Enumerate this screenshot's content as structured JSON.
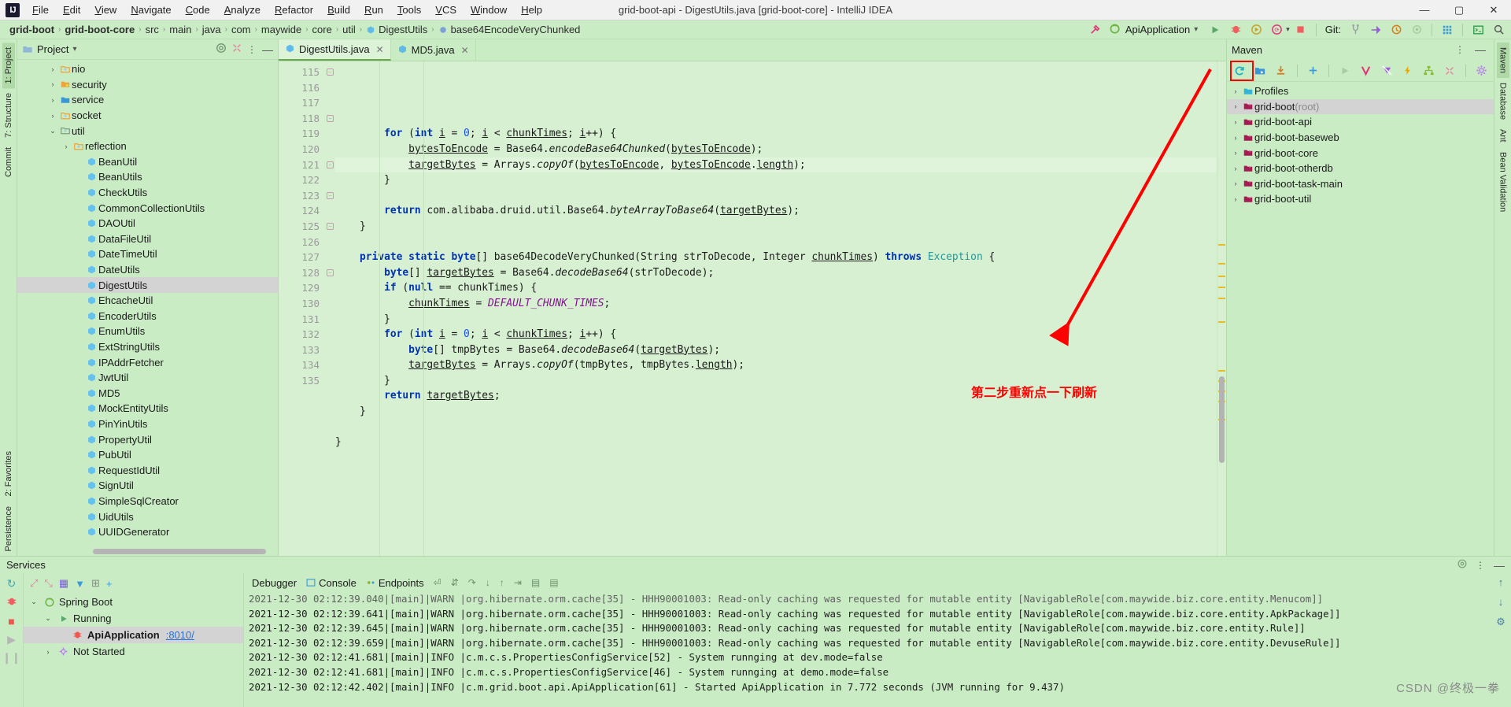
{
  "window": {
    "title": "grid-boot-api - DigestUtils.java [grid-boot-core] - IntelliJ IDEA",
    "minimize": "—",
    "maximize": "▢",
    "close": "✕"
  },
  "menu": [
    "File",
    "Edit",
    "View",
    "Navigate",
    "Code",
    "Analyze",
    "Refactor",
    "Build",
    "Run",
    "Tools",
    "VCS",
    "Window",
    "Help"
  ],
  "breadcrumb": [
    {
      "label": "grid-boot",
      "bold": true,
      "icon": ""
    },
    {
      "label": "grid-boot-core",
      "bold": true,
      "icon": ""
    },
    {
      "label": "src",
      "bold": false,
      "icon": ""
    },
    {
      "label": "main",
      "bold": false,
      "icon": ""
    },
    {
      "label": "java",
      "bold": false,
      "icon": ""
    },
    {
      "label": "com",
      "bold": false,
      "icon": ""
    },
    {
      "label": "maywide",
      "bold": false,
      "icon": ""
    },
    {
      "label": "core",
      "bold": false,
      "icon": ""
    },
    {
      "label": "util",
      "bold": false,
      "icon": ""
    },
    {
      "label": "DigestUtils",
      "bold": false,
      "icon": "class-icon"
    },
    {
      "label": "base64EncodeVeryChunked",
      "bold": false,
      "icon": "method-icon"
    }
  ],
  "toolbar": {
    "build_icon": "hammer-icon",
    "run_config": "ApiApplication",
    "run_config_icon": "spring-boot-icon",
    "dropdown_icon": "chevron-down-icon",
    "run_icon": "run-icon",
    "debug_icon": "debug-icon",
    "run_coverage_icon": "run-with-coverage-icon",
    "profile_icon": "profiler-icon",
    "stop_icon": "stop-icon",
    "git_label": "Git:",
    "branch_icon": "branch-icon",
    "update_icon": "update-project-icon",
    "history_icon": "history-icon",
    "commit_icon": "commit-icon",
    "layout_icon": "layout-icon",
    "terminal_icon": "terminal-icon",
    "search_icon": "search-icon"
  },
  "left_strip": [
    {
      "label": "1: Project",
      "icon": "project-icon",
      "active": true
    },
    {
      "label": "7: Structure",
      "icon": "structure-icon",
      "active": false
    },
    {
      "label": "Commit",
      "icon": "commit-icon",
      "active": false
    }
  ],
  "left_strip_bottom": [
    {
      "label": "2: Favorites",
      "icon": "favorites-icon"
    },
    {
      "label": "Persistence",
      "icon": "persistence-icon"
    }
  ],
  "right_strip": [
    {
      "label": "Maven",
      "icon": "maven-icon",
      "active": true
    },
    {
      "label": "Database",
      "icon": "database-icon",
      "active": false
    },
    {
      "label": "Ant",
      "icon": "ant-icon",
      "active": false
    },
    {
      "label": "Bean Validation",
      "icon": "bean-validation-icon",
      "active": false
    }
  ],
  "project_panel": {
    "title": "Project",
    "title_icon": "folder-icon",
    "dropdown_icon": "chevron-down-icon",
    "locate_icon": "target-icon",
    "collapse_icon": "collapse-all-icon",
    "options_icon": "more-options-icon",
    "hide_icon": "minimize-icon",
    "tree": [
      {
        "label": "nio",
        "indent": 2,
        "arrow": "›",
        "icon": "package-folder-icon",
        "selected": false
      },
      {
        "label": "security",
        "indent": 2,
        "arrow": "›",
        "icon": "folder-lock-icon",
        "selected": false
      },
      {
        "label": "service",
        "indent": 2,
        "arrow": "›",
        "icon": "folder-source-icon",
        "selected": false
      },
      {
        "label": "socket",
        "indent": 2,
        "arrow": "›",
        "icon": "package-folder-icon",
        "selected": false
      },
      {
        "label": "util",
        "indent": 2,
        "arrow": "⌄",
        "icon": "folder-icon",
        "selected": false
      },
      {
        "label": "reflection",
        "indent": 3,
        "arrow": "›",
        "icon": "package-folder-icon",
        "selected": false
      },
      {
        "label": "BeanUtil",
        "indent": 4,
        "arrow": "",
        "icon": "class-icon",
        "selected": false
      },
      {
        "label": "BeanUtils",
        "indent": 4,
        "arrow": "",
        "icon": "class-icon",
        "selected": false
      },
      {
        "label": "CheckUtils",
        "indent": 4,
        "arrow": "",
        "icon": "class-icon",
        "selected": false
      },
      {
        "label": "CommonCollectionUtils",
        "indent": 4,
        "arrow": "",
        "icon": "class-icon",
        "selected": false
      },
      {
        "label": "DAOUtil",
        "indent": 4,
        "arrow": "",
        "icon": "class-icon",
        "selected": false
      },
      {
        "label": "DataFileUtil",
        "indent": 4,
        "arrow": "",
        "icon": "class-icon",
        "selected": false
      },
      {
        "label": "DateTimeUtil",
        "indent": 4,
        "arrow": "",
        "icon": "class-icon",
        "selected": false
      },
      {
        "label": "DateUtils",
        "indent": 4,
        "arrow": "",
        "icon": "class-icon",
        "selected": false
      },
      {
        "label": "DigestUtils",
        "indent": 4,
        "arrow": "",
        "icon": "class-icon",
        "selected": true
      },
      {
        "label": "EhcacheUtil",
        "indent": 4,
        "arrow": "",
        "icon": "class-icon",
        "selected": false
      },
      {
        "label": "EncoderUtils",
        "indent": 4,
        "arrow": "",
        "icon": "class-icon",
        "selected": false
      },
      {
        "label": "EnumUtils",
        "indent": 4,
        "arrow": "",
        "icon": "class-icon",
        "selected": false
      },
      {
        "label": "ExtStringUtils",
        "indent": 4,
        "arrow": "",
        "icon": "class-icon",
        "selected": false
      },
      {
        "label": "IPAddrFetcher",
        "indent": 4,
        "arrow": "",
        "icon": "class-icon",
        "selected": false
      },
      {
        "label": "JwtUtil",
        "indent": 4,
        "arrow": "",
        "icon": "class-icon",
        "selected": false
      },
      {
        "label": "MD5",
        "indent": 4,
        "arrow": "",
        "icon": "class-icon",
        "selected": false
      },
      {
        "label": "MockEntityUtils",
        "indent": 4,
        "arrow": "",
        "icon": "class-icon",
        "selected": false
      },
      {
        "label": "PinYinUtils",
        "indent": 4,
        "arrow": "",
        "icon": "class-icon",
        "selected": false
      },
      {
        "label": "PropertyUtil",
        "indent": 4,
        "arrow": "",
        "icon": "class-icon",
        "selected": false
      },
      {
        "label": "PubUtil",
        "indent": 4,
        "arrow": "",
        "icon": "class-icon",
        "selected": false
      },
      {
        "label": "RequestIdUtil",
        "indent": 4,
        "arrow": "",
        "icon": "class-icon",
        "selected": false
      },
      {
        "label": "SignUtil",
        "indent": 4,
        "arrow": "",
        "icon": "class-icon",
        "selected": false
      },
      {
        "label": "SimpleSqlCreator",
        "indent": 4,
        "arrow": "",
        "icon": "class-icon",
        "selected": false
      },
      {
        "label": "UidUtils",
        "indent": 4,
        "arrow": "",
        "icon": "class-icon",
        "selected": false
      },
      {
        "label": "UUIDGenerator",
        "indent": 4,
        "arrow": "",
        "icon": "class-icon",
        "selected": false
      }
    ]
  },
  "editor": {
    "tabs": [
      {
        "label": "DigestUtils.java",
        "icon": "java-file-icon",
        "active": true,
        "close": "✕"
      },
      {
        "label": "MD5.java",
        "icon": "java-file-icon",
        "active": false,
        "close": "✕"
      }
    ],
    "first_line_number": 115,
    "highlight_line": 117,
    "lines": [
      {
        "n": 115,
        "fold": "−",
        "html": "        <span class=\"kw\">for</span> (<span class=\"kw\">int</span> <span class=\"ul\">i</span> = <span class=\"num\">0</span>; <span class=\"ul\">i</span> &lt; <span class=\"ul\">chunkTimes</span>; <span class=\"ul\">i</span>++) {"
      },
      {
        "n": 116,
        "fold": "",
        "html": "            <span class=\"ul\">bytesToEncode</span> = Base64.<span class=\"ital\">encodeBase64Chunked</span>(<span class=\"ul\">bytesToEncode</span>);"
      },
      {
        "n": 117,
        "fold": "",
        "html": "            <span class=\"ul\">targetBytes</span> = Arrays.<span class=\"ital\">copyOf</span>(<span class=\"ul\">bytesToEncode</span>, <span class=\"ul\">bytesToEncode</span>.<span class=\"ul\">length</span>);"
      },
      {
        "n": 118,
        "fold": "−",
        "html": "        }"
      },
      {
        "n": 119,
        "fold": "",
        "html": ""
      },
      {
        "n": 120,
        "fold": "",
        "html": "        <span class=\"kw\">return</span> com.alibaba.druid.util.Base64.<span class=\"ital\">byteArrayToBase64</span>(<span class=\"ul\">targetBytes</span>);"
      },
      {
        "n": 121,
        "fold": "−",
        "html": "    }"
      },
      {
        "n": 122,
        "fold": "",
        "html": ""
      },
      {
        "n": 123,
        "fold": "−",
        "html": "    <span class=\"kw\">private static byte</span>[] base64DecodeVeryChunked(String strToDecode, Integer <span class=\"ul\">chunkTimes</span>) <span class=\"kw\">throws</span> <span class=\"typ\">Exception</span> {"
      },
      {
        "n": 124,
        "fold": "",
        "html": "        <span class=\"kw\">byte</span>[] <span class=\"ul\">targetBytes</span> = Base64.<span class=\"ital\">decodeBase64</span>(strToDecode);"
      },
      {
        "n": 125,
        "fold": "−",
        "html": "        <span class=\"kw\">if</span> (<span class=\"kw\">null</span> == chunkTimes) {"
      },
      {
        "n": 126,
        "fold": "",
        "html": "            <span class=\"ul\">chunkTimes</span> = <span class=\"ital\" style=\"color:#871094\">DEFAULT_CHUNK_TIMES</span>;"
      },
      {
        "n": 127,
        "fold": "",
        "html": "        }"
      },
      {
        "n": 128,
        "fold": "−",
        "html": "        <span class=\"kw\">for</span> (<span class=\"kw\">int</span> <span class=\"ul\">i</span> = <span class=\"num\">0</span>; <span class=\"ul\">i</span> &lt; <span class=\"ul\">chunkTimes</span>; <span class=\"ul\">i</span>++) {"
      },
      {
        "n": 129,
        "fold": "",
        "html": "            <span class=\"kw\">byte</span>[] tmpBytes = Base64.<span class=\"ital\">decodeBase64</span>(<span class=\"ul\">targetBytes</span>);"
      },
      {
        "n": 130,
        "fold": "",
        "html": "            <span class=\"ul\">targetBytes</span> = Arrays.<span class=\"ital\">copyOf</span>(tmpBytes, tmpBytes.<span class=\"ul\">length</span>);"
      },
      {
        "n": 131,
        "fold": "",
        "html": "        }"
      },
      {
        "n": 132,
        "fold": "",
        "html": "        <span class=\"kw\">return</span> <span class=\"ul\">targetBytes</span>;"
      },
      {
        "n": 133,
        "fold": "",
        "html": "    }"
      },
      {
        "n": 134,
        "fold": "",
        "html": ""
      },
      {
        "n": 135,
        "fold": "",
        "html": "}"
      }
    ]
  },
  "maven_panel": {
    "title": "Maven",
    "options_icon": "more-options-icon",
    "hide_icon": "minimize-icon",
    "toolbar": [
      {
        "name": "reload-all-maven-projects-icon",
        "glyph": "↻",
        "color": "#1eb0c4",
        "highlighted": true
      },
      {
        "name": "add-maven-project-icon",
        "glyph": "",
        "color": "#3b96d6",
        "highlighted": false
      },
      {
        "name": "download-sources-icon",
        "glyph": "",
        "color": "#d97b1a",
        "highlighted": false
      },
      {
        "name": "add-icon",
        "glyph": "+",
        "color": "#3b9bd6",
        "highlighted": false
      },
      {
        "name": "run-maven-build-icon",
        "glyph": "▶",
        "color": "#9fc79a",
        "highlighted": false
      },
      {
        "name": "execute-maven-goal-icon",
        "glyph": "V",
        "color": "#e8337b",
        "highlighted": false
      },
      {
        "name": "toggle-skip-tests-icon",
        "glyph": "",
        "color": "#9b5ae0",
        "highlighted": false
      },
      {
        "name": "toggle-offline-mode-icon",
        "glyph": "⚡",
        "color": "#f0a500",
        "highlighted": false
      },
      {
        "name": "show-dependencies-icon",
        "glyph": "",
        "color": "#8aba2e",
        "highlighted": false
      },
      {
        "name": "collapse-all-icon",
        "glyph": "",
        "color": "#e87da0",
        "highlighted": false
      },
      {
        "name": "maven-settings-icon",
        "glyph": "✿",
        "color": "#b07ae8",
        "highlighted": false
      }
    ],
    "tree": [
      {
        "label": "Profiles",
        "suffix": "",
        "icon": "profiles-icon",
        "arrow": "›",
        "selected": false
      },
      {
        "label": "grid-boot",
        "suffix": " (root)",
        "icon": "maven-module-icon",
        "arrow": "›",
        "selected": true
      },
      {
        "label": "grid-boot-api",
        "suffix": "",
        "icon": "maven-module-icon",
        "arrow": "›",
        "selected": false
      },
      {
        "label": "grid-boot-baseweb",
        "suffix": "",
        "icon": "maven-module-icon",
        "arrow": "›",
        "selected": false
      },
      {
        "label": "grid-boot-core",
        "suffix": "",
        "icon": "maven-module-icon",
        "arrow": "›",
        "selected": false
      },
      {
        "label": "grid-boot-otherdb",
        "suffix": "",
        "icon": "maven-module-icon",
        "arrow": "›",
        "selected": false
      },
      {
        "label": "grid-boot-task-main",
        "suffix": "",
        "icon": "maven-module-icon",
        "arrow": "›",
        "selected": false
      },
      {
        "label": "grid-boot-util",
        "suffix": "",
        "icon": "maven-module-icon",
        "arrow": "›",
        "selected": false
      }
    ]
  },
  "annotation": {
    "text": "第二步重新点一下刷新",
    "color": "#ff0000",
    "arrow_name": "red-arrow-pointing-to-maven-reload"
  },
  "services": {
    "title": "Services",
    "settings_icon": "gear-icon",
    "options_icon": "more-options-icon",
    "hide_icon": "minimize-icon",
    "side_icons": [
      {
        "name": "rerun-icon",
        "glyph": "↻",
        "color": "#3aa7b8"
      },
      {
        "name": "debug-icon",
        "glyph": "",
        "color": "#e8337b"
      },
      {
        "name": "stop-icon",
        "glyph": "■",
        "color": "#f2564c"
      },
      {
        "name": "resume-icon",
        "glyph": "▶",
        "color": "#b6b6b6"
      },
      {
        "name": "pause-icon",
        "glyph": "❙❙",
        "color": "#b6b6b6"
      }
    ],
    "toolbar": [
      {
        "name": "expand-all-icon",
        "glyph": "⤢",
        "color": "#e87da0"
      },
      {
        "name": "collapse-all-icon",
        "glyph": "⤡",
        "color": "#e87da0"
      },
      {
        "name": "group-by-icon",
        "glyph": "▦",
        "color": "#7b61d6"
      },
      {
        "name": "filter-icon",
        "glyph": "▼",
        "color": "#3b9bd6"
      },
      {
        "name": "add-tab-icon",
        "glyph": "⊞",
        "color": "#8a8a8a"
      },
      {
        "name": "add-service-icon",
        "glyph": "+",
        "color": "#3b9bd6"
      }
    ],
    "tree": [
      {
        "label": "Spring Boot",
        "indent": 0,
        "arrow": "⌄",
        "icon": "spring-boot-icon",
        "selected": false,
        "bold": false,
        "link": ""
      },
      {
        "label": "Running",
        "indent": 1,
        "arrow": "⌄",
        "icon": "run-icon",
        "selected": false,
        "bold": false,
        "link": ""
      },
      {
        "label": "ApiApplication",
        "indent": 2,
        "arrow": "",
        "icon": "spring-app-icon",
        "selected": true,
        "bold": true,
        "link": ":8010/"
      },
      {
        "label": "Not Started",
        "indent": 1,
        "arrow": "›",
        "icon": "not-started-icon",
        "selected": false,
        "bold": false,
        "link": ""
      }
    ],
    "console_tabs": [
      {
        "label": "Debugger",
        "icon": ""
      },
      {
        "label": "Console",
        "icon": "console-icon"
      },
      {
        "label": "Endpoints",
        "icon": "endpoints-icon"
      }
    ],
    "console_toolbar": [
      {
        "name": "soft-wrap-icon",
        "glyph": "⏎"
      },
      {
        "name": "scroll-to-end-icon",
        "glyph": "⇵"
      },
      {
        "name": "step-over-icon",
        "glyph": "↷"
      },
      {
        "name": "step-into-icon",
        "glyph": "↓"
      },
      {
        "name": "step-out-icon",
        "glyph": "↑"
      },
      {
        "name": "run-to-cursor-icon",
        "glyph": "⇥"
      },
      {
        "name": "evaluate-icon",
        "glyph": "▤"
      },
      {
        "name": "print-icon",
        "glyph": "▤"
      }
    ],
    "console_lines": [
      "2021-12-30 02:12:39.040|[main]|WARN |org.hibernate.orm.cache[35] - HHH90001003: Read-only caching was requested for mutable entity [NavigableRole[com.maywide.biz.core.entity.Menucom]]",
      "2021-12-30 02:12:39.641|[main]|WARN |org.hibernate.orm.cache[35] - HHH90001003: Read-only caching was requested for mutable entity [NavigableRole[com.maywide.biz.core.entity.ApkPackage]]",
      "2021-12-30 02:12:39.645|[main]|WARN |org.hibernate.orm.cache[35] - HHH90001003: Read-only caching was requested for mutable entity [NavigableRole[com.maywide.biz.core.entity.Rule]]",
      "2021-12-30 02:12:39.659|[main]|WARN |org.hibernate.orm.cache[35] - HHH90001003: Read-only caching was requested for mutable entity [NavigableRole[com.maywide.biz.core.entity.DevuseRule]]",
      "2021-12-30 02:12:41.681|[main]|INFO |c.m.c.s.PropertiesConfigService[52] - System runnging at dev.mode=false",
      "2021-12-30 02:12:41.681|[main]|INFO |c.m.c.s.PropertiesConfigService[46] - System runnging at demo.mode=false",
      "2021-12-30 02:12:42.402|[main]|INFO |c.m.grid.boot.api.ApiApplication[61] - Started ApiApplication in 7.772 seconds (JVM running for 9.437)"
    ],
    "console_right_icons": [
      {
        "name": "scroll-up-icon",
        "glyph": "↑"
      },
      {
        "name": "scroll-down-icon",
        "glyph": "↓"
      },
      {
        "name": "settings-icon",
        "glyph": "⚙"
      }
    ]
  },
  "watermark": "CSDN @终极一拳"
}
